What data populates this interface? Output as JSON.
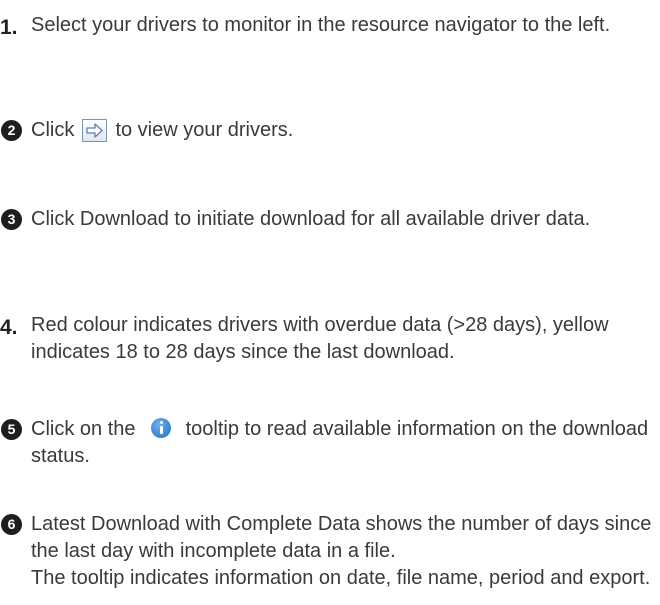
{
  "steps": [
    {
      "marker": "1.",
      "style": "number",
      "text": "Select your drivers to monitor in the resource navigator to the left."
    },
    {
      "marker": "2",
      "style": "circle",
      "before": "Click",
      "icon": "arrow-button-icon",
      "after": "to view your drivers."
    },
    {
      "marker": "3",
      "style": "circle",
      "text": "Click Download to initiate download for all available driver data."
    },
    {
      "marker": "4.",
      "style": "number",
      "text": "Red colour indicates drivers with overdue data (>28 days), yellow indicates 18 to 28 days since the last download."
    },
    {
      "marker": "5",
      "style": "circle",
      "before": "Click on the",
      "icon": "info-icon",
      "after": "tooltip to read available information on the download status."
    },
    {
      "marker": "6",
      "style": "circle",
      "text": "Latest Download with Complete Data shows the number of days since the last day with incomplete data in a file.",
      "text2": "The tooltip indicates information on date, file name, period and export."
    }
  ],
  "colors": {
    "text": "#3a3a3a",
    "marker": "#1e1e1e",
    "info_icon": "#1e6ec4",
    "arrow_button_border": "#7d95b4"
  }
}
